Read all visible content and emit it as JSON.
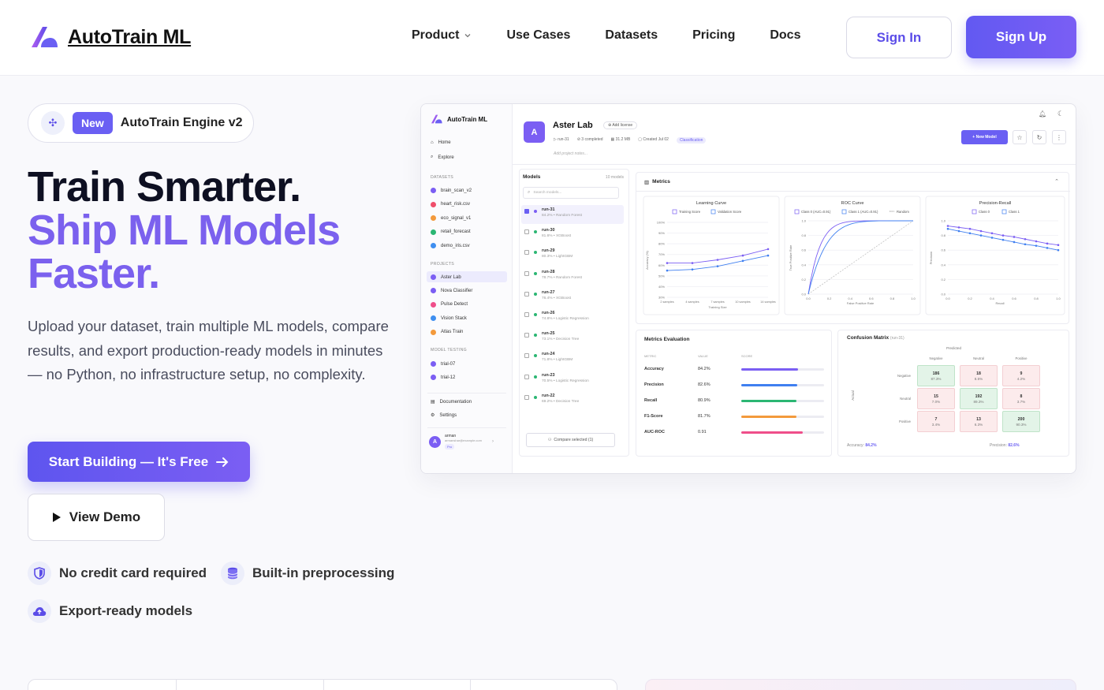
{
  "brand": {
    "name": "AutoTrain ML",
    "accent": "#6a5ff3"
  },
  "nav": {
    "items": [
      {
        "label": "Product"
      },
      {
        "label": "Use Cases"
      },
      {
        "label": "Datasets"
      },
      {
        "label": "Pricing"
      },
      {
        "label": "Docs"
      }
    ],
    "sign_in": "Sign In",
    "sign_up": "Sign Up"
  },
  "hero": {
    "badge_new": "New",
    "badge_text": "AutoTrain Engine v2",
    "title_line1": "Train Smarter.",
    "title_line2": "Ship ML Models",
    "title_line3": "Faster.",
    "subtitle": "Upload your dataset, train multiple ML models, compare results, and export production-ready models in minutes — no Python, no infrastructure setup, no complexity.",
    "cta_primary": "Start Building — It's Free",
    "cta_secondary": "View Demo",
    "features": [
      "No credit card required",
      "Built-in preprocessing",
      "Export-ready models"
    ]
  },
  "app_preview": {
    "brand": "AutoTrain ML",
    "sidebar": {
      "nav": [
        "Home",
        "Explore"
      ],
      "datasets_title": "DATASETS",
      "datasets": [
        {
          "name": "brain_scan_v2",
          "color": "#7b5ef3"
        },
        {
          "name": "heart_risk.csv",
          "color": "#ef4e6a"
        },
        {
          "name": "eco_signal_v1",
          "color": "#f39a3c"
        },
        {
          "name": "retail_forecast",
          "color": "#2bb673"
        },
        {
          "name": "demo_iris.csv",
          "color": "#3f8ff0"
        }
      ],
      "projects_title": "PROJECTS",
      "projects": [
        {
          "name": "Aster Lab",
          "color": "#7b5ef3"
        },
        {
          "name": "Nova Classifier",
          "color": "#7b5ef3"
        },
        {
          "name": "Pulse Detect",
          "color": "#ef4e8a"
        },
        {
          "name": "Vision Stack",
          "color": "#3f8ff0"
        },
        {
          "name": "Atlas Train",
          "color": "#f39a3c"
        }
      ],
      "testing_title": "MODEL TESTING",
      "testing": [
        {
          "name": "trial-07"
        },
        {
          "name": "trial-12"
        }
      ],
      "footer": [
        "Documentation",
        "Settings"
      ],
      "user": {
        "initial": "A",
        "name": "arman",
        "email": "armanshar@example.com",
        "plan": "Pro"
      }
    },
    "project": {
      "initial": "A",
      "name": "Aster Lab",
      "add_license": "Add license",
      "meta": [
        "run-31",
        "3 completed",
        "31.2 MB",
        "Created Jul 02",
        "Classification"
      ],
      "notes_placeholder": "Add project notes...",
      "new_model": "+ New Model"
    },
    "models": {
      "title": "Models",
      "count": "10 models",
      "search_placeholder": "Search models...",
      "runs": [
        {
          "name": "run-31",
          "detail": "84.2% • Random Forest",
          "color": "#7b5ef3",
          "checked": true
        },
        {
          "name": "run-30",
          "detail": "81.6% • XGBoost",
          "color": "#2bb673",
          "checked": false
        },
        {
          "name": "run-29",
          "detail": "80.3% • LightGBM",
          "color": "#2bb673",
          "checked": false
        },
        {
          "name": "run-28",
          "detail": "78.7% • Random Forest",
          "color": "#2bb673",
          "checked": false
        },
        {
          "name": "run-27",
          "detail": "76.4% • XGBoost",
          "color": "#2bb673",
          "checked": false
        },
        {
          "name": "run-26",
          "detail": "74.8% • Logistic Regression",
          "color": "#2bb673",
          "checked": false
        },
        {
          "name": "run-25",
          "detail": "73.1% • Decision Tree",
          "color": "#2bb673",
          "checked": false
        },
        {
          "name": "run-24",
          "detail": "71.8% • LightGBM",
          "color": "#2bb673",
          "checked": false
        },
        {
          "name": "run-23",
          "detail": "70.5% • Logistic Regression",
          "color": "#2bb673",
          "checked": false
        },
        {
          "name": "run-22",
          "detail": "69.2% • Decision Tree",
          "color": "#2bb673",
          "checked": false
        }
      ],
      "compare": "Compare selected (1)"
    },
    "metrics": {
      "title": "Metrics",
      "learning_curve": {
        "title": "Learning Curve",
        "legend": [
          "Training Score",
          "Validation Score"
        ],
        "yticks": [
          "100%",
          "90%",
          "80%",
          "70%",
          "60%",
          "50%",
          "40%",
          "30%"
        ],
        "xticks": [
          "2 samples",
          "4 samples",
          "7 samples",
          "10 samples",
          "14 samples"
        ],
        "xlabel": "Training Size",
        "ylabel": "Accuracy (%)"
      },
      "roc_curve": {
        "title": "ROC Curve",
        "legend": [
          "Class 0 (AUC=0.91)",
          "Class 1 (AUC=0.91)",
          "Random"
        ],
        "ticks": [
          "0.0",
          "0.2",
          "0.4",
          "0.6",
          "0.8",
          "1.0"
        ],
        "xlabel": "False Positive Rate",
        "ylabel": "True Positive Rate"
      },
      "pr_curve": {
        "title": "Precision-Recall",
        "legend": [
          "Class 0",
          "Class 1"
        ],
        "ticks": [
          "0.0",
          "0.2",
          "0.4",
          "0.6",
          "0.8",
          "1.0"
        ],
        "xlabel": "Recall",
        "ylabel": "Precision"
      }
    },
    "evaluation": {
      "title": "Metrics Evaluation",
      "headers": [
        "METRIC",
        "VALUE",
        "SCORE"
      ],
      "rows": [
        {
          "metric": "Accuracy",
          "value": "84.2%",
          "score": 0.842,
          "color": "#7b5ef3"
        },
        {
          "metric": "Precision",
          "value": "82.6%",
          "score": 0.826,
          "color": "#3f7ff0"
        },
        {
          "metric": "Recall",
          "value": "80.9%",
          "score": 0.809,
          "color": "#2bb673"
        },
        {
          "metric": "F1-Score",
          "value": "81.7%",
          "score": 0.817,
          "color": "#f39a3c"
        },
        {
          "metric": "AUC-ROC",
          "value": "0.91",
          "score": 0.91,
          "color": "#ef4e8a"
        }
      ]
    },
    "confusion": {
      "title": "Confusion Matrix",
      "run": "(run-31)",
      "predicted": "Predicted",
      "actual": "Actual",
      "labels": [
        "Negative",
        "Neutral",
        "Positive"
      ],
      "cells": [
        [
          {
            "v": "186",
            "p": "87.3%"
          },
          {
            "v": "18",
            "p": "8.5%"
          },
          {
            "v": "9",
            "p": "4.2%"
          }
        ],
        [
          {
            "v": "15",
            "p": "7.0%"
          },
          {
            "v": "192",
            "p": "89.3%"
          },
          {
            "v": "8",
            "p": "3.7%"
          }
        ],
        [
          {
            "v": "7",
            "p": "3.4%"
          },
          {
            "v": "13",
            "p": "6.3%"
          },
          {
            "v": "200",
            "p": "90.3%"
          }
        ]
      ],
      "accuracy_label": "Accuracy:",
      "accuracy": "84.2%",
      "precision_label": "Precision:",
      "precision": "82.6%"
    }
  }
}
